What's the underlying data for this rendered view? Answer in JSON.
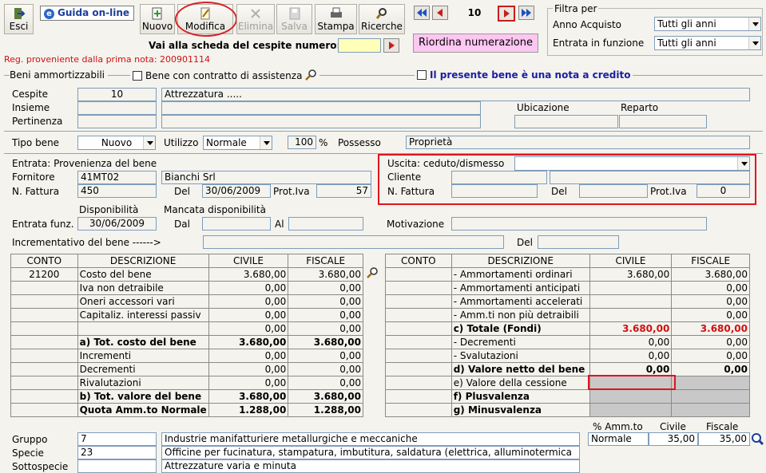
{
  "toolbar": {
    "esci": "Esci",
    "guida": "Guida on-line",
    "nuovo": "Nuovo",
    "modifica": "Modifica",
    "elimina": "Elimina",
    "salva": "Salva",
    "stampa": "Stampa",
    "ricerche": "Ricerche",
    "record": "10",
    "vai_label": "Vai alla scheda del cespite numero:",
    "riordina": "Riordina numerazione"
  },
  "filtro": {
    "title": "Filtra per",
    "anno_label": "Anno Acquisto",
    "anno_value": "Tutti gli anni",
    "entrata_label": "Entrata in funzione",
    "entrata_value": "Tutti gli anni"
  },
  "reg_note": "Reg. proveniente dalla prima nota: 200901114",
  "section": {
    "beni": "Beni ammortizzabili",
    "contratto": "Bene con contratto di assistenza",
    "nota": "Il presente bene è una nota a credito"
  },
  "cespite": {
    "label": "Cespite",
    "value": "10",
    "descr": "Attrezzatura .....",
    "insieme": "Insieme",
    "pertinenza": "Pertinenza",
    "ubicazione": "Ubicazione",
    "reparto": "Reparto"
  },
  "tipo": {
    "label": "Tipo bene",
    "value": "Nuovo",
    "utilizzo_label": "Utilizzo",
    "utilizzo_value": "Normale",
    "perc": "100",
    "perc_sign": "%",
    "possesso_label": "Possesso",
    "possesso_value": "Proprietà"
  },
  "entrata": {
    "title": "Entrata: Provenienza del bene",
    "fornitore_label": "Fornitore",
    "fornitore_code": "41MT02",
    "fornitore_name": "Bianchi Srl",
    "fattura_label": "N. Fattura",
    "fattura": "450",
    "del_label": "Del",
    "del": "30/06/2009",
    "prot_label": "Prot.Iva",
    "prot": "57"
  },
  "uscita": {
    "title": "Uscita: ceduto/dismesso",
    "cliente_label": "Cliente",
    "fattura_label": "N. Fattura",
    "del_label": "Del",
    "prot_label": "Prot.Iva",
    "prot": "0"
  },
  "disp": {
    "disponibilita": "Disponibilità",
    "mancata": "Mancata disponibilità",
    "entrata_label": "Entrata funz.",
    "entrata": "30/06/2009",
    "dal": "Dal",
    "al": "Al",
    "motivazione": "Motivazione",
    "incrementativo": "Incrementativo del bene ------>",
    "del": "Del"
  },
  "left_table": {
    "headers": [
      "CONTO",
      "DESCRIZIONE",
      "CIVILE",
      "FISCALE"
    ],
    "rows": [
      [
        "21200",
        "Costo del bene",
        "3.680,00",
        "3.680,00"
      ],
      [
        "",
        "Iva non detraibile",
        "0,00",
        "0,00"
      ],
      [
        "",
        "Oneri accessori vari",
        "0,00",
        "0,00"
      ],
      [
        "",
        "Capitaliz. interessi passiv",
        "0,00",
        "0,00"
      ],
      [
        "",
        "",
        "0,00",
        "0,00"
      ],
      [
        "",
        "a) Tot. costo del bene",
        "3.680,00",
        "3.680,00"
      ],
      [
        "",
        "Incrementi",
        "0,00",
        "0,00"
      ],
      [
        "",
        "Decrementi",
        "0,00",
        "0,00"
      ],
      [
        "",
        "Rivalutazioni",
        "0,00",
        "0,00"
      ],
      [
        "",
        "b) Tot. valore del bene",
        "3.680,00",
        "3.680,00"
      ],
      [
        "",
        "Quota Amm.to Normale",
        "1.288,00",
        "1.288,00"
      ]
    ]
  },
  "right_table": {
    "headers": [
      "CONTO",
      "DESCRIZIONE",
      "CIVILE",
      "FISCALE"
    ],
    "rows": [
      [
        "",
        "- Ammortamenti ordinari",
        "3.680,00",
        "3.680,00"
      ],
      [
        "",
        "- Ammortamenti anticipati",
        "",
        "0,00"
      ],
      [
        "",
        "- Ammortamenti accelerati",
        "",
        "0,00"
      ],
      [
        "",
        "- Amm.ti non più detraibili",
        "",
        "0,00"
      ],
      [
        "",
        "c) Totale (Fondi)",
        "3.680,00",
        "3.680,00"
      ],
      [
        "",
        "- Decrementi",
        "0,00",
        "0,00"
      ],
      [
        "",
        "- Svalutazioni",
        "0,00",
        "0,00"
      ],
      [
        "",
        "d) Valore netto del bene",
        "0,00",
        "0,00"
      ],
      [
        "",
        "e) Valore della cessione",
        "",
        ""
      ],
      [
        "",
        "f) Plusvalenza",
        "",
        ""
      ],
      [
        "",
        "g) Minusvalenza",
        "",
        ""
      ]
    ]
  },
  "gruppo": {
    "label": "Gruppo",
    "code": "7",
    "descr": "Industrie manifatturiere metallurgiche e meccaniche",
    "specie_label": "Specie",
    "specie_code": "23",
    "specie_descr": "Officine per fucinatura, stampatura, imbutitura, saldatura (elettrica, alluminotermica",
    "sottospecie_label": "Sottospecie",
    "sottospecie_descr": "Attrezzature varia e minuta"
  },
  "amm": {
    "perc_label": "% Amm.to",
    "civile_label": "Civile",
    "fiscale_label": "Fiscale",
    "tipo": "Normale",
    "civile": "35,00",
    "fiscale": "35,00"
  }
}
